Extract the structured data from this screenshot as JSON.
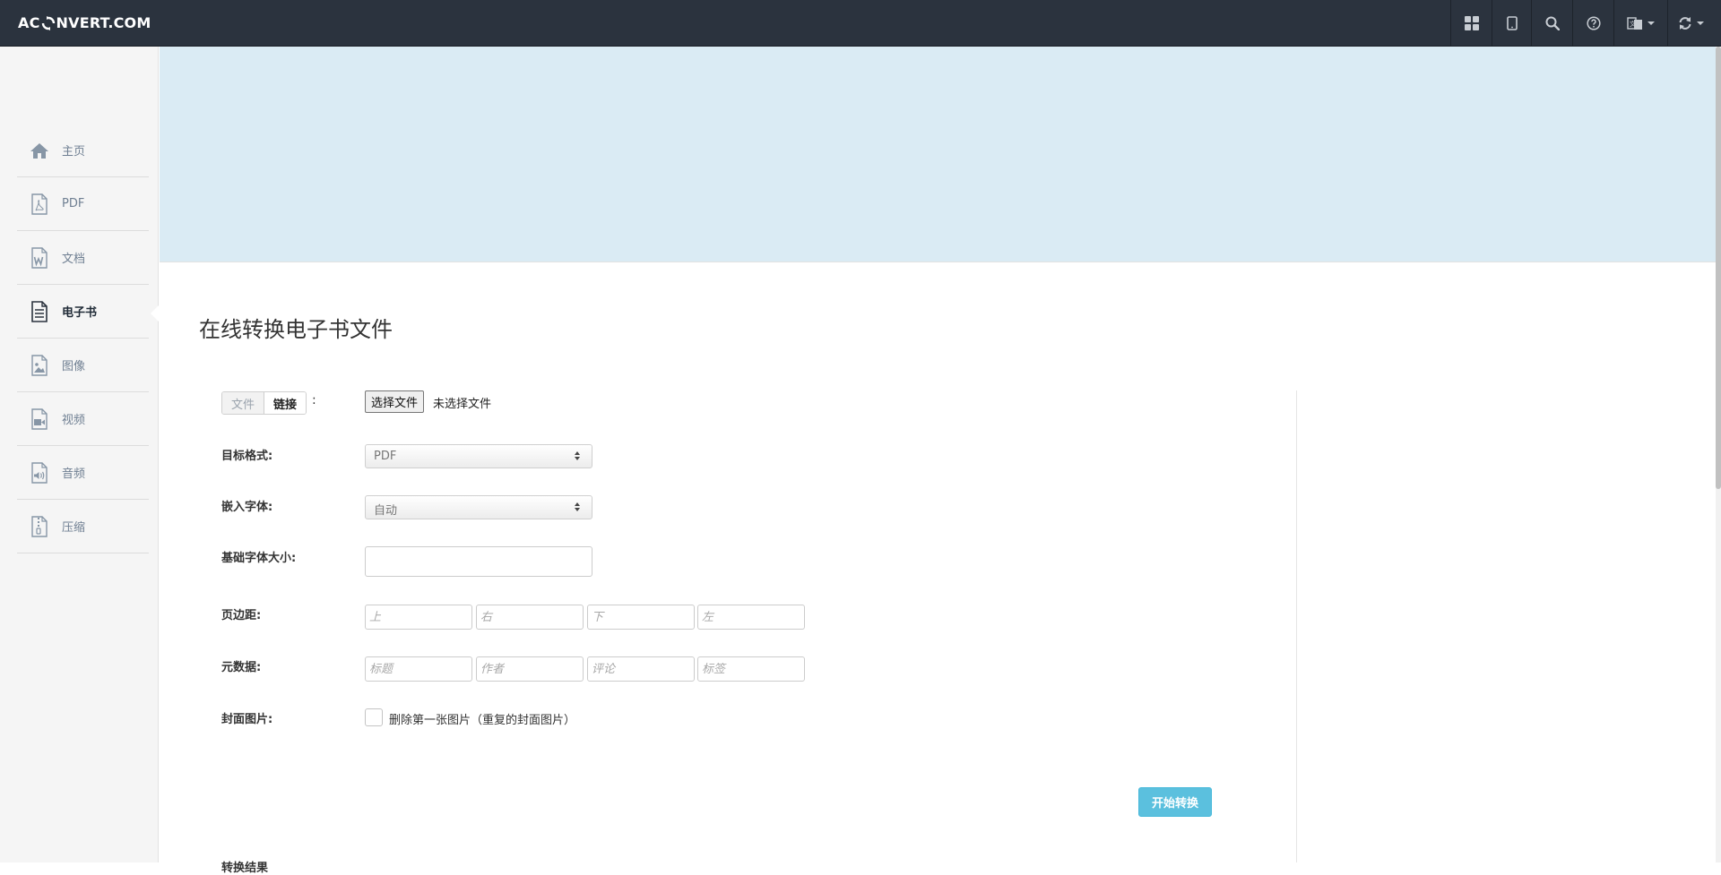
{
  "header": {
    "logo_left": "AC",
    "logo_right": "NVERT.COM",
    "nav_icons": [
      "grid-icon",
      "tablet-icon",
      "search-icon",
      "help-icon",
      "language-icon",
      "refresh-icon"
    ]
  },
  "sidebar": {
    "items": [
      {
        "label": "主页",
        "icon": "home-icon"
      },
      {
        "label": "PDF",
        "icon": "pdf-icon"
      },
      {
        "label": "文档",
        "icon": "word-doc-icon"
      },
      {
        "label": "电子书",
        "icon": "ebook-icon",
        "active": true
      },
      {
        "label": "图像",
        "icon": "image-icon"
      },
      {
        "label": "视频",
        "icon": "video-icon"
      },
      {
        "label": "音频",
        "icon": "audio-icon"
      },
      {
        "label": "压缩",
        "icon": "archive-icon"
      }
    ]
  },
  "main": {
    "title": "在线转换电子书文件",
    "source": {
      "tab_file": "文件",
      "tab_link": "链接",
      "colon": ":",
      "choose_button": "选择文件",
      "no_file": "未选择文件"
    },
    "target_format": {
      "label": "目标格式:",
      "value": "PDF"
    },
    "embed_font": {
      "label": "嵌入字体:",
      "value": "自动"
    },
    "base_font_size": {
      "label": "基础字体大小:",
      "value": ""
    },
    "margins": {
      "label": "页边距:",
      "top_placeholder": "上",
      "right_placeholder": "右",
      "bottom_placeholder": "下",
      "left_placeholder": "左"
    },
    "metadata": {
      "label": "元数据:",
      "title_placeholder": "标题",
      "author_placeholder": "作者",
      "comment_placeholder": "评论",
      "tags_placeholder": "标签"
    },
    "cover": {
      "label": "封面图片:",
      "checkbox_label": "删除第一张图片（重复的封面图片）",
      "checked": false
    },
    "convert_button": "开始转换",
    "result_heading": "转换结果"
  },
  "colors": {
    "navbar": "#2b333e",
    "banner": "#daebf4",
    "sidebar": "#f5f5f5",
    "accent_button": "#5bc0de"
  }
}
